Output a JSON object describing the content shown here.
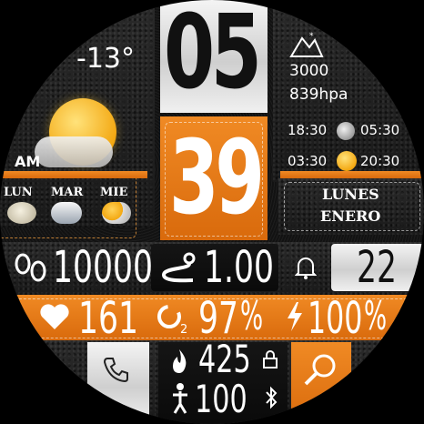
{
  "time": {
    "hours": "05",
    "minutes": "39",
    "ampm": "AM"
  },
  "weather": {
    "temperature": "-13°",
    "pressure_altitude": "3000",
    "pressure": "839hpa",
    "moonrise": "18:30",
    "moonset": "05:30",
    "sunrise": "03:30",
    "sunset": "20:30",
    "forecast": [
      {
        "day": "LUN",
        "icon": "cloudy-icon"
      },
      {
        "day": "MAR",
        "icon": "snow-cloud-icon"
      },
      {
        "day": "MIE",
        "icon": "partly-cloudy-icon"
      }
    ]
  },
  "date": {
    "weekday": "LUNES",
    "month": "ENERO"
  },
  "stats": {
    "steps": "10000",
    "distance": "1.00",
    "notifications": "22",
    "heart_rate": "161",
    "spo2": "97",
    "spo2_unit": "%",
    "battery": "100",
    "battery_unit": "%",
    "calories": "425",
    "floors": "100"
  },
  "colors": {
    "accent": "#e87a1a",
    "text": "#ffffff",
    "metal": "#e6e6e6"
  }
}
